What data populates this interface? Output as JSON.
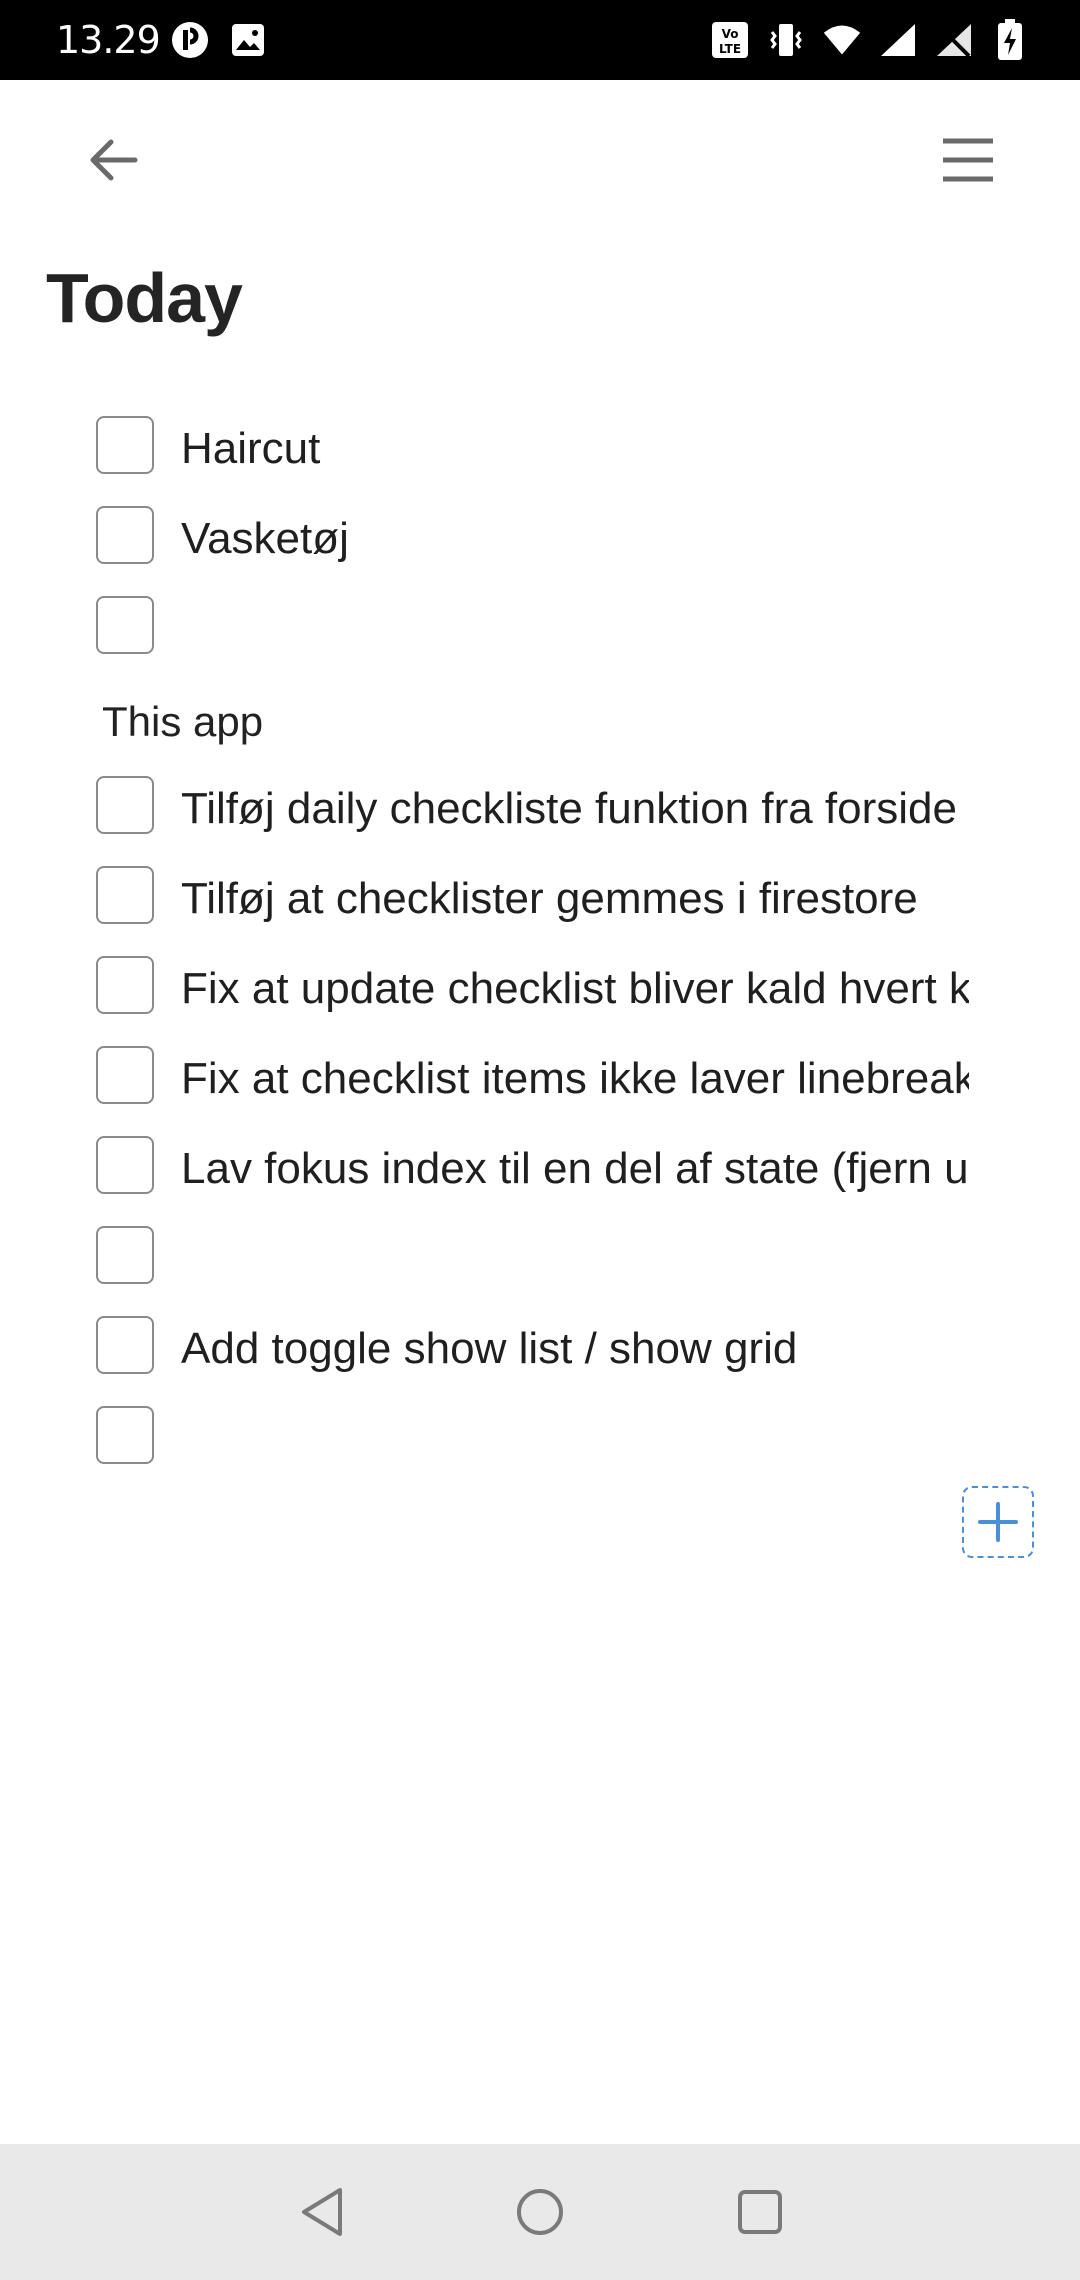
{
  "status_bar": {
    "time": "13.29",
    "left_icons": [
      "app-notification-icon",
      "image-icon"
    ],
    "right_icons": [
      "volte-icon",
      "vibrate-icon",
      "wifi-icon",
      "signal-icon",
      "no-signal-icon",
      "battery-charging-icon"
    ]
  },
  "app_bar": {
    "back_icon": "arrow-left-icon",
    "menu_icon": "hamburger-menu-icon"
  },
  "page": {
    "title": "Today"
  },
  "checklist": {
    "group1": [
      {
        "text": "Haircut",
        "checked": false
      },
      {
        "text": "Vasketøj",
        "checked": false
      },
      {
        "text": "",
        "checked": false
      }
    ],
    "section_label": "This app",
    "group2": [
      {
        "text": "Tilføj daily checkliste funktion fra forside",
        "checked": false
      },
      {
        "text": "Tilføj at checklister gemmes i firestore",
        "checked": false
      },
      {
        "text": "Fix at update checklist bliver kald hvert k",
        "checked": false
      },
      {
        "text": "Fix at checklist items ikke laver linebreak",
        "checked": false
      },
      {
        "text": "Lav fokus index til en del af state (fjern u",
        "checked": false
      },
      {
        "text": "",
        "checked": false
      },
      {
        "text": "Add toggle show list / show grid",
        "checked": false
      },
      {
        "text": "",
        "checked": false
      }
    ]
  },
  "add_button": {
    "icon": "plus-icon",
    "color": "#4a8fd8"
  },
  "nav_bar": {
    "icons": [
      "back-triangle-icon",
      "home-circle-icon",
      "recents-square-icon"
    ]
  }
}
